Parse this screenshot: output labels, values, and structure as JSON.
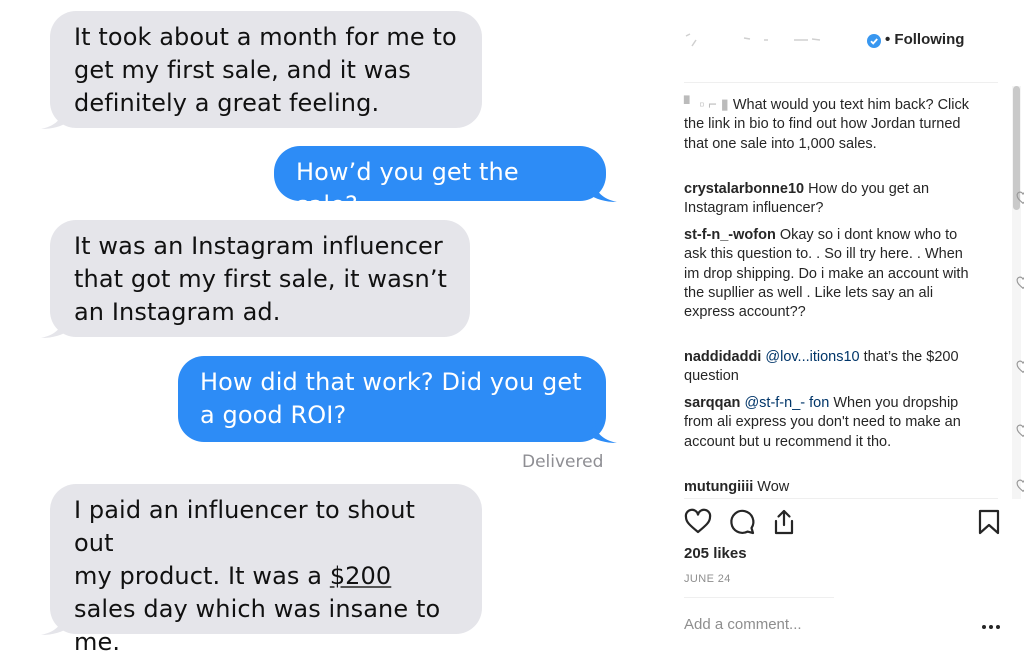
{
  "chat": {
    "messages": [
      {
        "dir": "in",
        "text": "It took about a month for me to\nget my first sale, and it was\ndefinitely a great feeling."
      },
      {
        "dir": "out",
        "text": "How’d you get the sale?"
      },
      {
        "dir": "in",
        "text": "It was an Instagram influencer\nthat got my first sale, it wasn’t\nan Instagram ad."
      },
      {
        "dir": "out",
        "text": "How did that work? Did you get\na good ROI?"
      },
      {
        "dir": "in",
        "text_before": "I paid an influencer to shout out\nmy product. It was a ",
        "text_underlined": "$200",
        "text_after": "\nsales day which was insane to\nme."
      }
    ],
    "status": "Delivered",
    "colors": {
      "incoming": "#e5e5ea",
      "outgoing": "#2d8cf6"
    }
  },
  "instagram": {
    "header": {
      "username": "",
      "following_label": "• Following"
    },
    "caption": {
      "username": "",
      "text": "What would you text him back? Click the link in bio to find out how Jordan turned that one sale into 1,000 sales."
    },
    "comments": [
      {
        "username": "crystalarbonne10",
        "text": "How do you get an Instagram influencer?"
      },
      {
        "username": "st-f-n_-wofon",
        "text": "Okay so i dont know who to ask this question to. . So ill try here. . When im drop shipping. Do i make an account with the supllier as well . Like lets say an ali express account??"
      },
      {
        "username": "naddidaddi",
        "mention": "@lov...itions10",
        "text": "that’s the $200 question"
      },
      {
        "username": "sarqqan",
        "mention": "@st-f-n_- fon",
        "text": "When you dropship from ali express you don't need to make an account but u recommend it tho."
      },
      {
        "username": "mutungiiii",
        "text": "Wow"
      }
    ],
    "likes": "205 likes",
    "date": "JUNE 24",
    "add_comment_placeholder": "Add a comment...",
    "icons": [
      "heart-icon",
      "comment-icon",
      "share-icon",
      "bookmark-icon",
      "more-icon",
      "verified-badge-icon"
    ],
    "colors": {
      "verified": "#3897f0",
      "mention": "#003569",
      "secondary_text": "#8e8e8e"
    }
  }
}
